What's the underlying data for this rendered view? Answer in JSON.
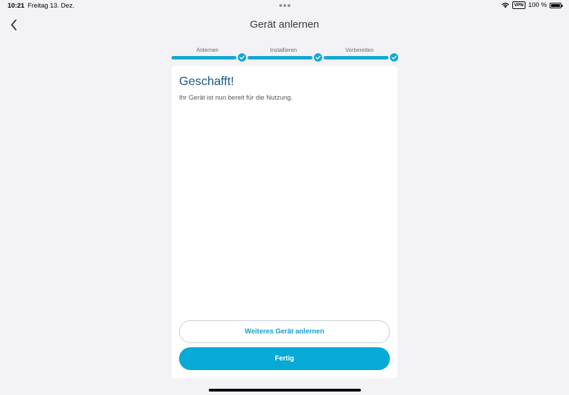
{
  "status_bar": {
    "time": "10:21",
    "date": "Freitag 13. Dez.",
    "vpn": "VPN",
    "battery": "100 %"
  },
  "header": {
    "title": "Gerät anlernen",
    "back_icon": "chevron-left-icon"
  },
  "stepper": {
    "steps": [
      {
        "label": "Anlernen",
        "completed": true
      },
      {
        "label": "Installieren",
        "completed": true
      },
      {
        "label": "Vorbereiten",
        "completed": true
      }
    ],
    "check_icon": "checkmark-icon"
  },
  "card": {
    "title": "Geschafft!",
    "text": "Ihr Gerät ist nun bereit für die Nutzung."
  },
  "actions": {
    "secondary_label": "Weiteres Gerät anlernen",
    "primary_label": "Fertig"
  },
  "colors": {
    "accent": "#07aad6",
    "title": "#1d5a86",
    "background": "#f2f2f7"
  }
}
